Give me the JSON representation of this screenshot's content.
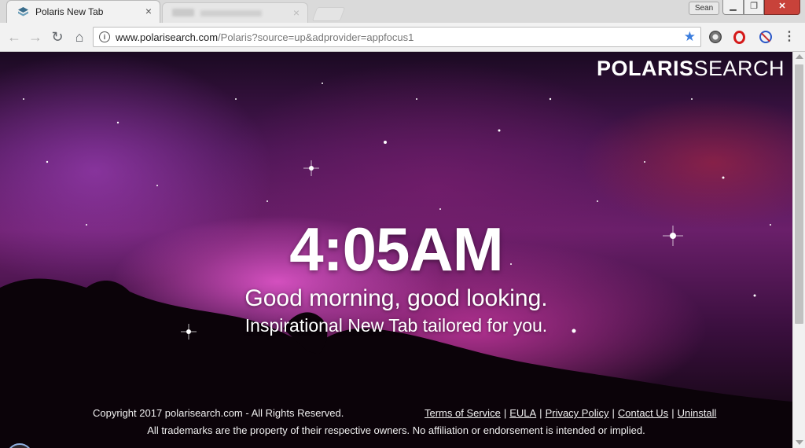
{
  "window": {
    "user_name": "Sean",
    "minimize_label": "▁",
    "maximize_label": "❐",
    "close_label": "✕"
  },
  "tabs": [
    {
      "title": "Polaris New Tab",
      "active": true
    }
  ],
  "toolbar": {
    "url_host": "www.polarisearch.com",
    "url_path": "/Polaris?source=up&adprovider=appfocus1",
    "icons": [
      "back-icon",
      "forward-icon",
      "reload-icon",
      "home-icon",
      "info-icon",
      "star-icon",
      "extension-gear-icon",
      "opera-icon",
      "block-icon",
      "menu-icon"
    ]
  },
  "page": {
    "logo_bold": "POLARIS",
    "logo_light": "SEARCH",
    "time": "4:05AM",
    "greeting": "Good morning, good looking.",
    "tagline": "Inspirational New Tab tailored for you.",
    "copyright": "Copyright 2017 polarisearch.com - All Rights Reserved.",
    "links": {
      "terms": "Terms of Service",
      "eula": "EULA",
      "privacy": "Privacy Policy",
      "contact": "Contact Us",
      "uninstall": "Uninstall",
      "separator": "|"
    },
    "disclaimer": "All trademarks are the property of their respective owners. No affiliation or endorsement is intended or implied."
  },
  "colors": {
    "accent_star": "#3b7ddd",
    "close_button": "#c8423a",
    "nebula_pink": "#eb5ad2",
    "nebula_purple": "#6a1f6a"
  }
}
